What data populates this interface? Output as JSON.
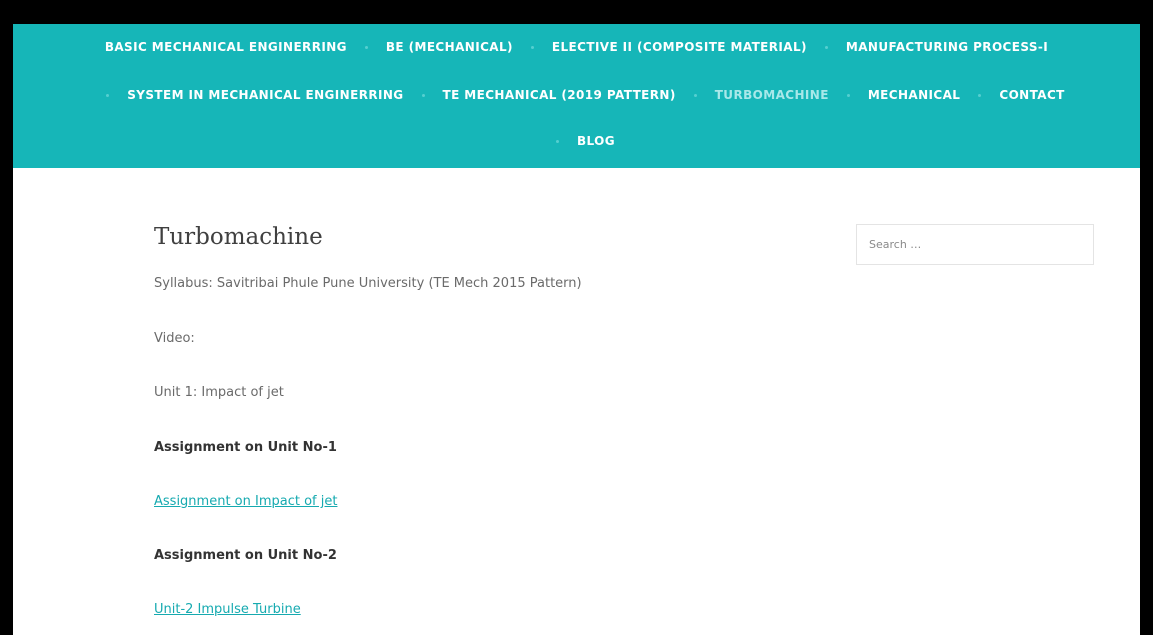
{
  "nav": {
    "row1": [
      {
        "label": "BASIC MECHANICAL ENGINERRING",
        "active": false
      },
      {
        "label": "BE (MECHANICAL)",
        "active": false
      },
      {
        "label": "ELECTIVE II (COMPOSITE MATERIAL)",
        "active": false
      },
      {
        "label": "MANUFACTURING PROCESS-I",
        "active": false
      }
    ],
    "row2": [
      {
        "label": "SYSTEM IN MECHANICAL ENGINERRING",
        "active": false
      },
      {
        "label": "TE MECHANICAL (2019 PATTERN)",
        "active": false
      },
      {
        "label": "TURBOMACHINE",
        "active": true
      },
      {
        "label": "MECHANICAL",
        "active": false
      },
      {
        "label": "CONTACT",
        "active": false
      }
    ],
    "row3": [
      {
        "label": "BLOG",
        "active": false
      }
    ]
  },
  "main": {
    "title": "Turbomachine",
    "syllabus": "Syllabus:  Savitribai Phule Pune University (TE Mech 2015 Pattern)",
    "video": "Video:",
    "unit1": "Unit 1: Impact of jet",
    "assignment1_heading": "Assignment on Unit No-1",
    "assignment1_link": "Assignment on Impact of jet",
    "assignment2_heading": "Assignment on Unit No-2",
    "assignment2_link": "Unit-2 Impulse Turbine"
  },
  "sidebar": {
    "search_placeholder": "Search …"
  },
  "colors": {
    "accent": "#16b6b8",
    "link": "#16aab0",
    "active_nav": "#a8e8e9"
  }
}
